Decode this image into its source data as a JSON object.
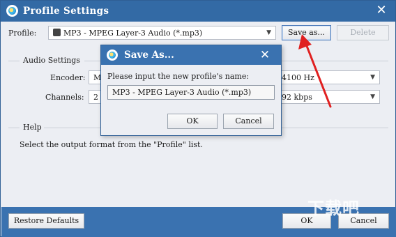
{
  "window": {
    "title": "Profile Settings",
    "icon": "app-icon",
    "close_icon": "close-icon"
  },
  "profile": {
    "label": "Profile:",
    "value": "MP3 - MPEG Layer-3 Audio (*.mp3)",
    "save_as_label": "Save as...",
    "delete_label": "Delete"
  },
  "audio": {
    "group_title": "Audio Settings",
    "encoder_label": "Encoder:",
    "encoder_value_partial": "M",
    "channels_label": "Channels:",
    "channels_value_partial": "2",
    "samplerate_value_partial": "4100 Hz",
    "bitrate_value_partial": "92 kbps"
  },
  "help": {
    "group_title": "Help",
    "text": "Select the output format from the \"Profile\" list."
  },
  "footer": {
    "restore_label": "Restore Defaults",
    "ok_label": "OK",
    "cancel_label": "Cancel"
  },
  "dialog": {
    "title": "Save As...",
    "prompt": "Please input the new profile's name:",
    "input_value": "MP3 - MPEG Layer-3 Audio (*.mp3)",
    "ok_label": "OK",
    "cancel_label": "Cancel"
  },
  "watermark": "下载吧",
  "colors": {
    "title_bar": "#336aa5",
    "footer_bar": "#3a72b0",
    "annotation_arrow": "#e02020"
  }
}
